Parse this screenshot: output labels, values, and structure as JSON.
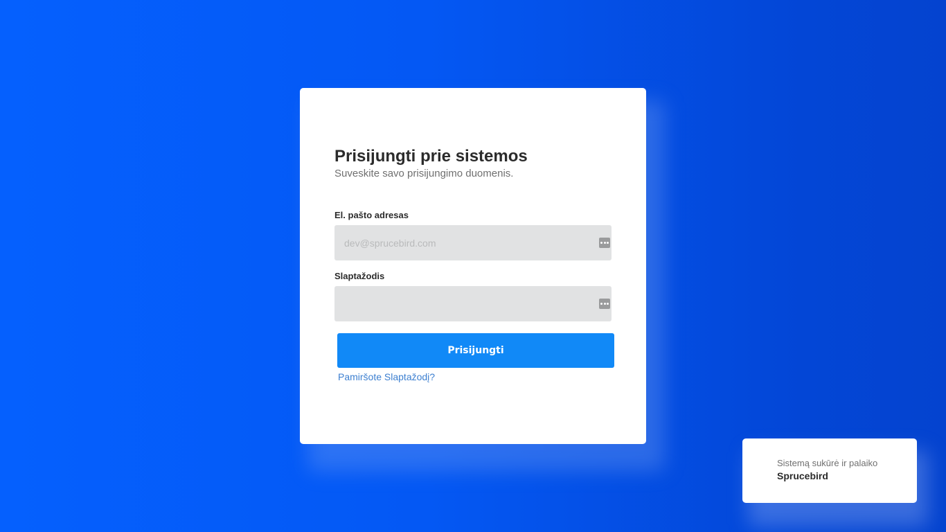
{
  "login": {
    "title": "Prisijungti prie sistemos",
    "subtitle": "Suveskite savo prisijungimo duomenis.",
    "email": {
      "label": "El. pašto adresas",
      "placeholder": "dev@sprucebird.com",
      "value": ""
    },
    "password": {
      "label": "Slaptažodis",
      "value": ""
    },
    "submit_label": "Prisijungti",
    "forgot_link": "Pamiršote Slaptažodį?"
  },
  "footer": {
    "text": "Sistemą sukūrė ir palaiko",
    "brand": "Sprucebird"
  },
  "icons": {
    "autofill": "password-manager-icon"
  },
  "colors": {
    "background": "#0458f4",
    "primary_button": "#1189f7",
    "link": "#3c7fd0",
    "input_bg": "#e1e2e3"
  }
}
